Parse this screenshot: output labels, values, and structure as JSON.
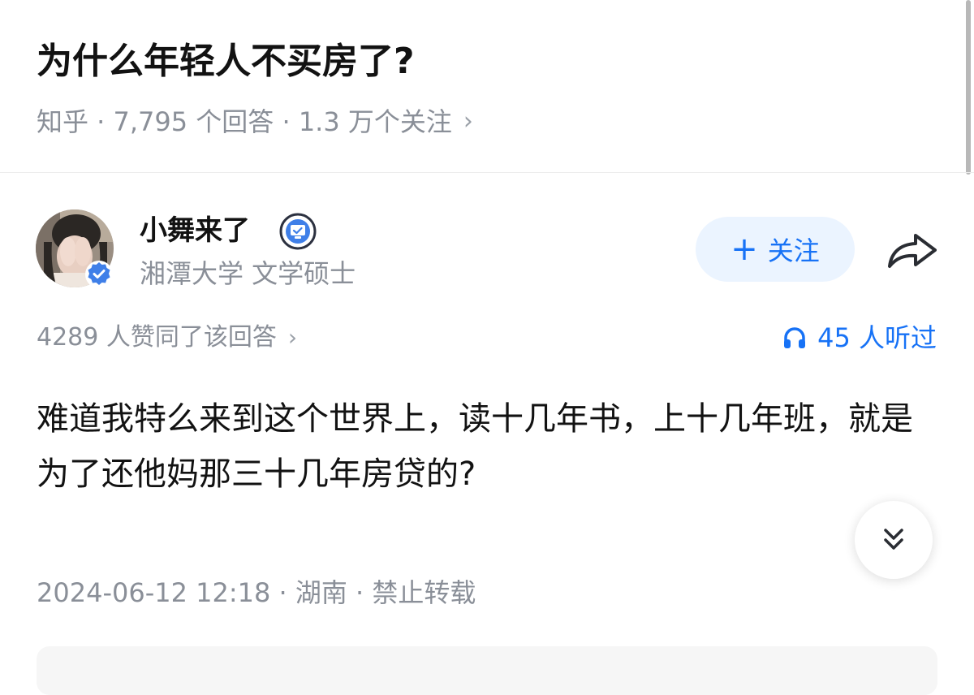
{
  "question": {
    "title": "为什么年轻人不买房了?",
    "meta": "知乎 · 7,795 个回答 · 1.3 万个关注",
    "chevron": "›"
  },
  "author": {
    "name": "小舞来了",
    "description": "湘潭大学 文学硕士",
    "follow_label": "关注",
    "follow_plus": "+"
  },
  "answer": {
    "approve_text": "4289 人赞同了该回答",
    "approve_chevron": "›",
    "listen_count": "45 人听过",
    "content": "难道我特么来到这个世界上，读十几年书，上十几年班，就是为了还他妈那三十几年房贷的?",
    "meta": "2024-06-12 12:18 · 湖南 · 禁止转载"
  },
  "icons": {
    "verified": "verified-check-icon",
    "badge": "creator-badge-icon",
    "share": "share-arrow-icon",
    "listen": "headphones-icon",
    "fab": "double-chevron-down-icon"
  },
  "colors": {
    "accent": "#1772f6",
    "follow_bg": "#ebf4ff",
    "muted_text": "#8a8f98",
    "primary_text": "#121212"
  }
}
